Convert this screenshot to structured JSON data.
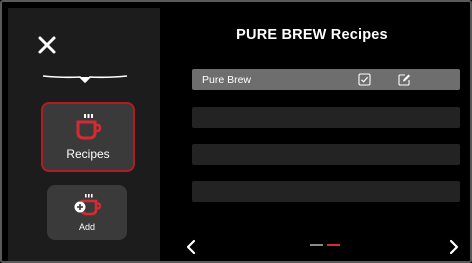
{
  "header": {
    "title": "PURE BREW Recipes"
  },
  "sidebar": {
    "close_icon": "close-icon",
    "nav": [
      {
        "label": "Recipes",
        "icon": "coffee-cup-icon",
        "active": true
      },
      {
        "label": "Add",
        "icon": "add-coffee-cup-icon",
        "active": false
      }
    ]
  },
  "recipes": {
    "rows": [
      {
        "label": "Pure Brew",
        "selected": true
      },
      {
        "label": "",
        "selected": false
      },
      {
        "label": "",
        "selected": false
      },
      {
        "label": "",
        "selected": false
      }
    ]
  },
  "pagination": {
    "current_page": 2,
    "total_pages": 2,
    "prev_icon": "chevron-left-icon",
    "next_icon": "chevron-right-icon"
  },
  "colors": {
    "accent": "#b01e24",
    "sidebar_bg": "#1c1c1c",
    "button_bg": "#3a3a3a",
    "row_selected_bg": "#6e6e6e",
    "row_empty_bg": "#232323"
  }
}
